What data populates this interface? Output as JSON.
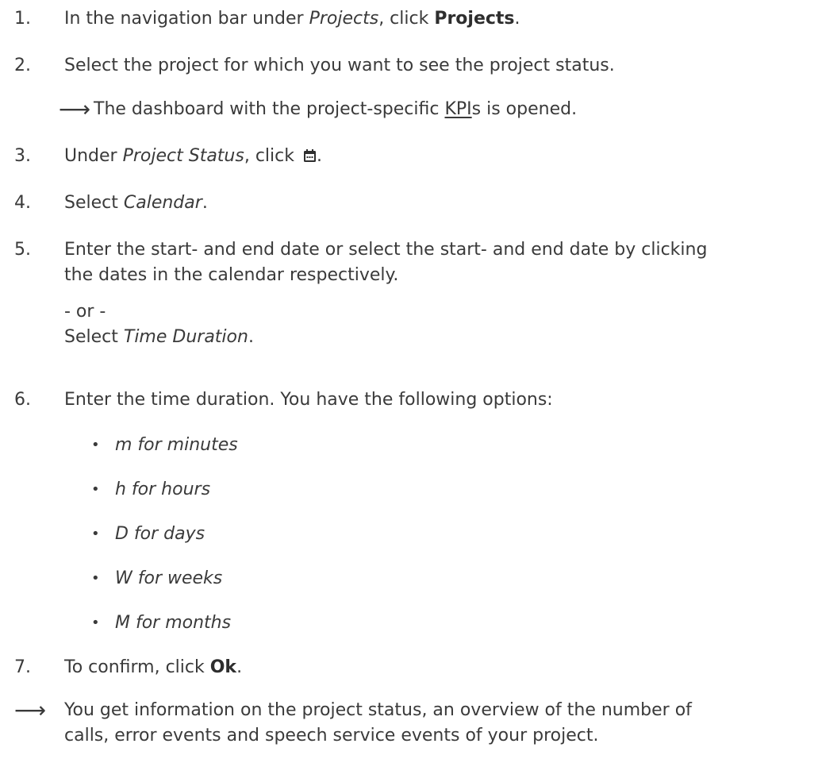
{
  "steps": [
    {
      "number": "1.",
      "prefix": "In the navigation bar under ",
      "italic": "Projects",
      "middle": ", click ",
      "bold": "Projects",
      "suffix": "."
    },
    {
      "number": "2.",
      "text": "Select the project for which you want to see the project status."
    },
    {
      "result_prefix": "The dashboard with the project-specific ",
      "kpi": "KPI",
      "result_suffix": "s is opened."
    },
    {
      "number": "3.",
      "prefix": "Under ",
      "italic": "Project Status",
      "middle": ", click ",
      "icon": "calendar-icon",
      "suffix": "."
    },
    {
      "number": "4.",
      "prefix": "Select ",
      "italic": "Calendar",
      "suffix": "."
    },
    {
      "number": "5.",
      "line1": "Enter the start- and end date or select the start- and end date by clicking",
      "line2": "the dates in the calendar respectively.",
      "or": "- or -",
      "alt_prefix": "Select ",
      "alt_italic": "Time Duration",
      "alt_suffix": "."
    },
    {
      "number": "6.",
      "text": "Enter the time duration. You have the following options:"
    },
    {
      "number": "7.",
      "prefix": "To confirm, click ",
      "bold": "Ok",
      "suffix": "."
    }
  ],
  "options": [
    "m for minutes",
    "h for hours",
    "D for days",
    "W for weeks",
    "M for months"
  ],
  "final_result": {
    "line1": "You get information on the project status, an overview of the number of",
    "line2": "calls, error events and speech service events of your project."
  },
  "arrow_glyph": "⟶",
  "bullet_glyph": "•"
}
